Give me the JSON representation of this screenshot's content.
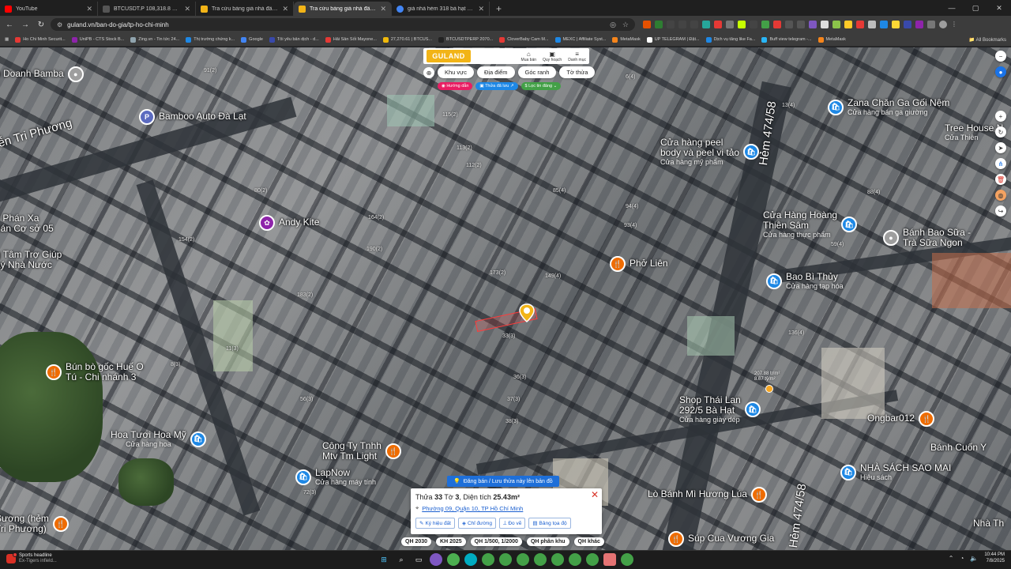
{
  "browser": {
    "tabs": [
      {
        "label": "YouTube",
        "color": "#ff0000",
        "active": false
      },
      {
        "label": "BTCUSDT.P 108,318.8 ▲ +0.11%",
        "color": "#2a2a2a",
        "active": false
      },
      {
        "label": "Tra cứu bảng giá nhà đất Xã Tà",
        "color": "#f2b417",
        "active": false
      },
      {
        "label": "Tra cứu bảng giá nhà đất Thành",
        "color": "#f2b417",
        "active": true
      },
      {
        "label": "giá nhà hẻm 318 bà hạt quận 1",
        "color": "#4285f4",
        "active": false
      }
    ],
    "url": "guland.vn/ban-do-gia/tp-ho-chi-minh",
    "bookmarks": [
      {
        "label": "Ho Chi Minh Securit...",
        "color": "#e53935"
      },
      {
        "label": "UniPB - CTS Stock B...",
        "color": "#8e24aa"
      },
      {
        "label": "Zing.vn - Tin tức 24...",
        "color": "#90a4ae"
      },
      {
        "label": "Thị trường chứng k...",
        "color": "#1e88e5"
      },
      {
        "label": "Google",
        "color": "#4285f4"
      },
      {
        "label": "Tôi yêu bản dịch - d...",
        "color": "#3949ab"
      },
      {
        "label": "Hải Sản Sốt Mayone...",
        "color": "#e53935"
      },
      {
        "label": "27,270.61 | BTCUS...",
        "color": "#f0b90b"
      },
      {
        "label": "BTCUSDTPERP 2070...",
        "color": "#222222"
      },
      {
        "label": "CloverBaby Cam M...",
        "color": "#e53935"
      },
      {
        "label": "MEXC | Affiliate Syst...",
        "color": "#1e88e5"
      },
      {
        "label": "MetaMask",
        "color": "#f6851b"
      },
      {
        "label": "UP TELEGRAM | Đặt...",
        "color": "#ffffff"
      },
      {
        "label": "Dịch vụ tăng like Fa...",
        "color": "#1e88e5"
      },
      {
        "label": "Buff view telegram -...",
        "color": "#29b6f6"
      },
      {
        "label": "MetaMask",
        "color": "#f6851b"
      }
    ],
    "all_bookmarks": "All Bookmarks"
  },
  "app": {
    "logo": "GULAND",
    "menu": [
      "Mua bán",
      "Quy hoạch",
      "Danh mục"
    ],
    "filters": [
      "Khu vực",
      "Địa điểm",
      "Góc ranh",
      "Tờ thửa"
    ],
    "chips": [
      {
        "label": "Hướng dẫn",
        "color": "#e91e63"
      },
      {
        "label": "Thửa đã lưu",
        "color": "#1e88e5"
      },
      {
        "label": "Lọc tin đăng",
        "color": "#43a047"
      }
    ]
  },
  "map": {
    "streets": [
      {
        "label": "ễn Tri Phương"
      },
      {
        "label": "Hẻm 474/58"
      },
      {
        "label": "Hẻm 474/58"
      }
    ],
    "pois": [
      {
        "name": "h Doanh Bamba",
        "sub": "",
        "color": "#9e9e9e",
        "icon": "pin-icon"
      },
      {
        "name": "Bamboo Auto Đà Lạt",
        "sub": "",
        "color": "#5c6bc0",
        "icon": "parking-icon"
      },
      {
        "name": "Andy Kite",
        "sub": "",
        "color": "#8e24aa",
        "icon": "shop-icon"
      },
      {
        "name": "ỳ Phán Xa",
        "sub": "",
        "color": "#9e9e9e",
        "icon": "pin-icon"
      },
      {
        "name": "hán Cơ sở 05",
        "sub": "",
        "color": "#9e9e9e",
        "icon": "pin-icon"
      },
      {
        "name": "g Tâm Trợ Giúp",
        "sub": "",
        "color": "#9e9e9e",
        "icon": "pin-icon"
      },
      {
        "name": "Lý Nhà Nước",
        "sub": "",
        "color": "#9e9e9e",
        "icon": "pin-icon"
      },
      {
        "name": "Bún bò gốc Huế O",
        "sub": "",
        "color": "#ef6c00",
        "icon": "food-icon"
      },
      {
        "name": "Tú - Chi nhánh 3",
        "sub": "",
        "color": "#ef6c00",
        "icon": "food-icon"
      },
      {
        "name": "Hoa Tươi Hoa Mỹ",
        "sub": "Cửa hàng hoa",
        "color": "#1e88e5",
        "icon": "shop-icon"
      },
      {
        "name": "Công Ty Tnhh",
        "sub": "",
        "color": "#ef6c00",
        "icon": "food-icon"
      },
      {
        "name": "Mtv Tm Light",
        "sub": "",
        "color": "#ef6c00",
        "icon": "food-icon"
      },
      {
        "name": "LapNow",
        "sub": "Cửa hàng máy tính",
        "color": "#1e88e5",
        "icon": "shop-icon"
      },
      {
        "name": "Sương (hẻm",
        "sub": "",
        "color": "#ef6c00",
        "icon": "food-icon"
      },
      {
        "name": "Tri Phương)",
        "sub": "",
        "color": "#ef6c00",
        "icon": "food-icon"
      },
      {
        "name": "Zana Chăn Ga Gối Nệm",
        "sub": "Cửa hàng bán ga giường",
        "color": "#1e88e5",
        "icon": "shop-icon"
      },
      {
        "name": "Tree House N",
        "sub": "Cửa Thiên",
        "color": "#1e88e5",
        "icon": "shop-icon"
      },
      {
        "name": "Cửa hàng peel",
        "sub": "",
        "color": "#1e88e5",
        "icon": "shop-icon"
      },
      {
        "name": "body và peel vi tảo",
        "sub": "Cửa hàng mỹ phẩm",
        "color": "#1e88e5",
        "icon": "shop-icon"
      },
      {
        "name": "Cửa Hàng Hoàng",
        "sub": "",
        "color": "#1e88e5",
        "icon": "shop-icon"
      },
      {
        "name": "Thiên Sâm",
        "sub": "Cửa hàng thực phẩm",
        "color": "#1e88e5",
        "icon": "shop-icon"
      },
      {
        "name": "Bánh Bao Sữa -",
        "sub": "",
        "color": "#9e9e9e",
        "icon": "pin-icon"
      },
      {
        "name": "Trà Sữa Ngon",
        "sub": "",
        "color": "#9e9e9e",
        "icon": "pin-icon"
      },
      {
        "name": "Phở Liên",
        "sub": "",
        "color": "#ef6c00",
        "icon": "food-icon"
      },
      {
        "name": "Bao Bì Thủy",
        "sub": "Cửa hàng tạp hóa",
        "color": "#1e88e5",
        "icon": "shop-icon"
      },
      {
        "name": "Shop Thái Lan",
        "sub": "",
        "color": "#1e88e5",
        "icon": "shop-icon"
      },
      {
        "name": "292/5 Bà Hạt",
        "sub": "Cửa hàng giày dép",
        "color": "#1e88e5",
        "icon": "shop-icon"
      },
      {
        "name": "Ongbar012",
        "sub": "",
        "color": "#ef6c00",
        "icon": "food-icon"
      },
      {
        "name": "Bánh Cuốn Y",
        "sub": "",
        "color": "#ef6c00",
        "icon": "food-icon"
      },
      {
        "name": "NHÀ SÁCH SAO MAI",
        "sub": "Hiệu sách",
        "color": "#1e88e5",
        "icon": "shop-icon"
      },
      {
        "name": "Lò Bánh Mì Hương Lúa",
        "sub": "",
        "color": "#ef6c00",
        "icon": "food-icon"
      },
      {
        "name": "Súp Cua Vương Gia",
        "sub": "",
        "color": "#ef6c00",
        "icon": "food-icon"
      },
      {
        "name": "Nhà Th",
        "sub": "",
        "color": "#ef6c00",
        "icon": "food-icon"
      }
    ],
    "plot_labels": [
      "91(2)",
      "115(2)",
      "113(2)",
      "112(2)",
      "80(2)",
      "164(2)",
      "154(2)",
      "190(2)",
      "173(2)",
      "183(2)",
      "149(4)",
      "85(4)",
      "94(4)",
      "93(4)",
      "11(3)",
      "8(3)",
      "56(3)",
      "36(3)",
      "37(3)",
      "38(3)",
      "33(3)",
      "72(3)",
      "136(4)",
      "13(4)",
      "59(4)",
      "6(4)",
      "88(4)"
    ],
    "price_tag": [
      "207.88 tr/m²",
      "8.67 tỷ/m²"
    ]
  },
  "popup": {
    "register": "Đăng bán / Lưu thửa này lên bản đồ",
    "parcel_prefix": "Thửa",
    "parcel_no": "33",
    "sheet_prefix": "Tờ",
    "sheet_no": "3",
    "area_prefix": "Diện tích",
    "area": "25.43m²",
    "address": "Phường 09, Quận 10, TP Hồ Chí Minh",
    "actions": [
      "Ký hiệu đất",
      "Chỉ đường",
      "Đo vẽ",
      "Bảng tọa độ"
    ]
  },
  "plans": [
    "QH 2030",
    "KH 2025",
    "QH 1/500, 1/2000",
    "QH phân khu",
    "QH khác"
  ],
  "taskbar": {
    "news_title": "Sports headline",
    "news_sub": "Ex-Tigers infield...",
    "time": "10:44 PM",
    "date": "7/8/2025"
  }
}
